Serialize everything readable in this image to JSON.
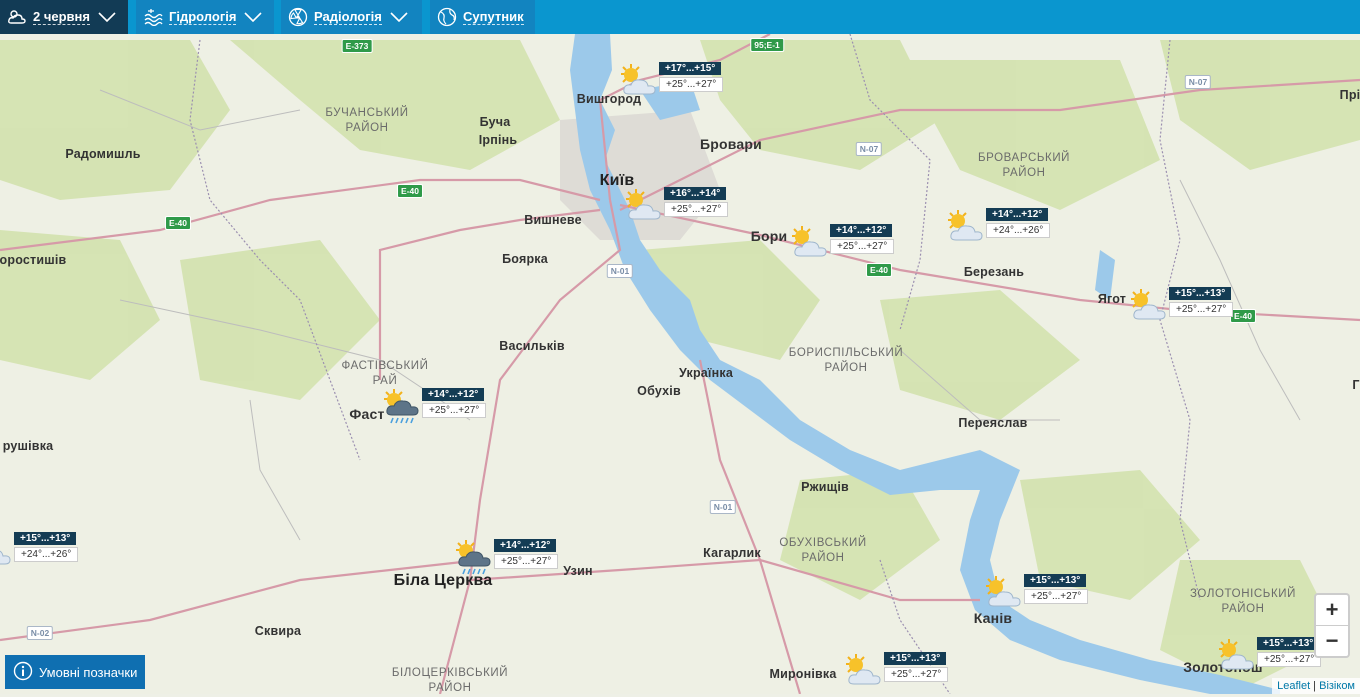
{
  "toolbar": {
    "date_label": "2 червня",
    "hydrology_label": "Гідрологія",
    "radiology_label": "Радіологія",
    "satellite_label": "Супутник"
  },
  "places": {
    "kyiv": "Київ",
    "vyshhorod": "Вишгород",
    "brovary": "Бровари",
    "bucha": "Буча",
    "irpin": "Ірпінь",
    "radomyshl": "Радомишль",
    "vyshneve": "Вишневе",
    "boiarka": "Боярка",
    "vasylkiv": "Васильків",
    "obukhiv": "Обухів",
    "ukrainka": "Українка",
    "fastiv": "Фаст",
    "bila_tserkva": "Біла Церква",
    "uzyn": "Узин",
    "kaharlyk": "Кагарлик",
    "rzhyshchiv": "Ржищів",
    "kaniv": "Канів",
    "myronivka": "Миронівка",
    "skvyra": "Сквира",
    "zolotonosha": "Золотонош",
    "pereiaslav": "Переяслав",
    "berezan": "Березань",
    "yahotyn": "Ягот",
    "boryspil": "Бори",
    "korostyshiv": "оростишів",
    "ruzhyn": "рушівка",
    "pry": "Прі",
    "edge_g": "Г"
  },
  "regions": {
    "buchanskyi": [
      "БУЧАНСЬКИЙ",
      "РАЙОН"
    ],
    "brovarskyi": [
      "БРОВАРСЬКИЙ",
      "РАЙОН"
    ],
    "boryspilskyi": [
      "БОРИСПІЛЬСЬКИЙ",
      "РАЙОН"
    ],
    "fastivskyi": [
      "ФАСТІВСЬКИЙ",
      "РАЙ"
    ],
    "obukhivskyi": [
      "ОБУХІВСЬКИЙ",
      "РАЙОН"
    ],
    "zolotoniskyi": [
      "ЗОЛОТОНІСЬКИЙ",
      "РАЙОН"
    ],
    "bilotserkivskyi": [
      "БІЛОЦЕРКІВСЬКИЙ",
      "РАЙОН"
    ]
  },
  "roads": {
    "e373": "E-373",
    "e40a": "E-40",
    "e40b": "E-40",
    "e40c": "E-40",
    "e40d": "E-40",
    "e95": "95;E-1",
    "n07a": "N-07",
    "n07b": "N-07",
    "n01a": "N-01",
    "n01b": "N-01",
    "n02": "N-02"
  },
  "weather": [
    {
      "id": "vyshhorod",
      "night": "+17°...+15°",
      "day": "+25°...+27°",
      "icon": "sun-cloud-icon"
    },
    {
      "id": "kyiv",
      "night": "+16°...+14°",
      "day": "+25°...+27°",
      "icon": "sun-cloud-icon"
    },
    {
      "id": "boryspil",
      "night": "+14°...+12°",
      "day": "+25°...+27°",
      "icon": "sun-cloud-icon"
    },
    {
      "id": "berezan",
      "night": "+14°...+12°",
      "day": "+24°...+26°",
      "icon": "sun-cloud-icon"
    },
    {
      "id": "yahotyn",
      "night": "+15°...+13°",
      "day": "+25°...+27°",
      "icon": "sun-cloud-icon"
    },
    {
      "id": "fastiv",
      "night": "+14°...+12°",
      "day": "+25°...+27°",
      "icon": "sun-rain-icon"
    },
    {
      "id": "west",
      "night": "+15°...+13°",
      "day": "+24°...+26°",
      "icon": "sun-cloud-icon"
    },
    {
      "id": "bila_tserkva",
      "night": "+14°...+12°",
      "day": "+25°...+27°",
      "icon": "sun-rain-icon"
    },
    {
      "id": "kaniv",
      "night": "+15°...+13°",
      "day": "+25°...+27°",
      "icon": "sun-cloud-icon"
    },
    {
      "id": "myronivka",
      "night": "+15°...+13°",
      "day": "+25°...+27°",
      "icon": "sun-cloud-icon"
    },
    {
      "id": "zolotonosha",
      "night": "+15°...+13°",
      "day": "+25°...+27°",
      "icon": "sun-cloud-icon"
    }
  ],
  "controls": {
    "zoom_in": "+",
    "zoom_out": "−",
    "legend_label": "Умовні позначки",
    "attrib_leaflet": "Leaflet",
    "attrib_sep": " | ",
    "attrib_visicom": "Візіком"
  },
  "colors": {
    "topbar": "#0a96cf",
    "active_tab": "#123b55",
    "water": "#8fc3e6",
    "forest": "#cfe0a8",
    "land": "#eef0e6",
    "temp_night_bg": "#143c54"
  }
}
